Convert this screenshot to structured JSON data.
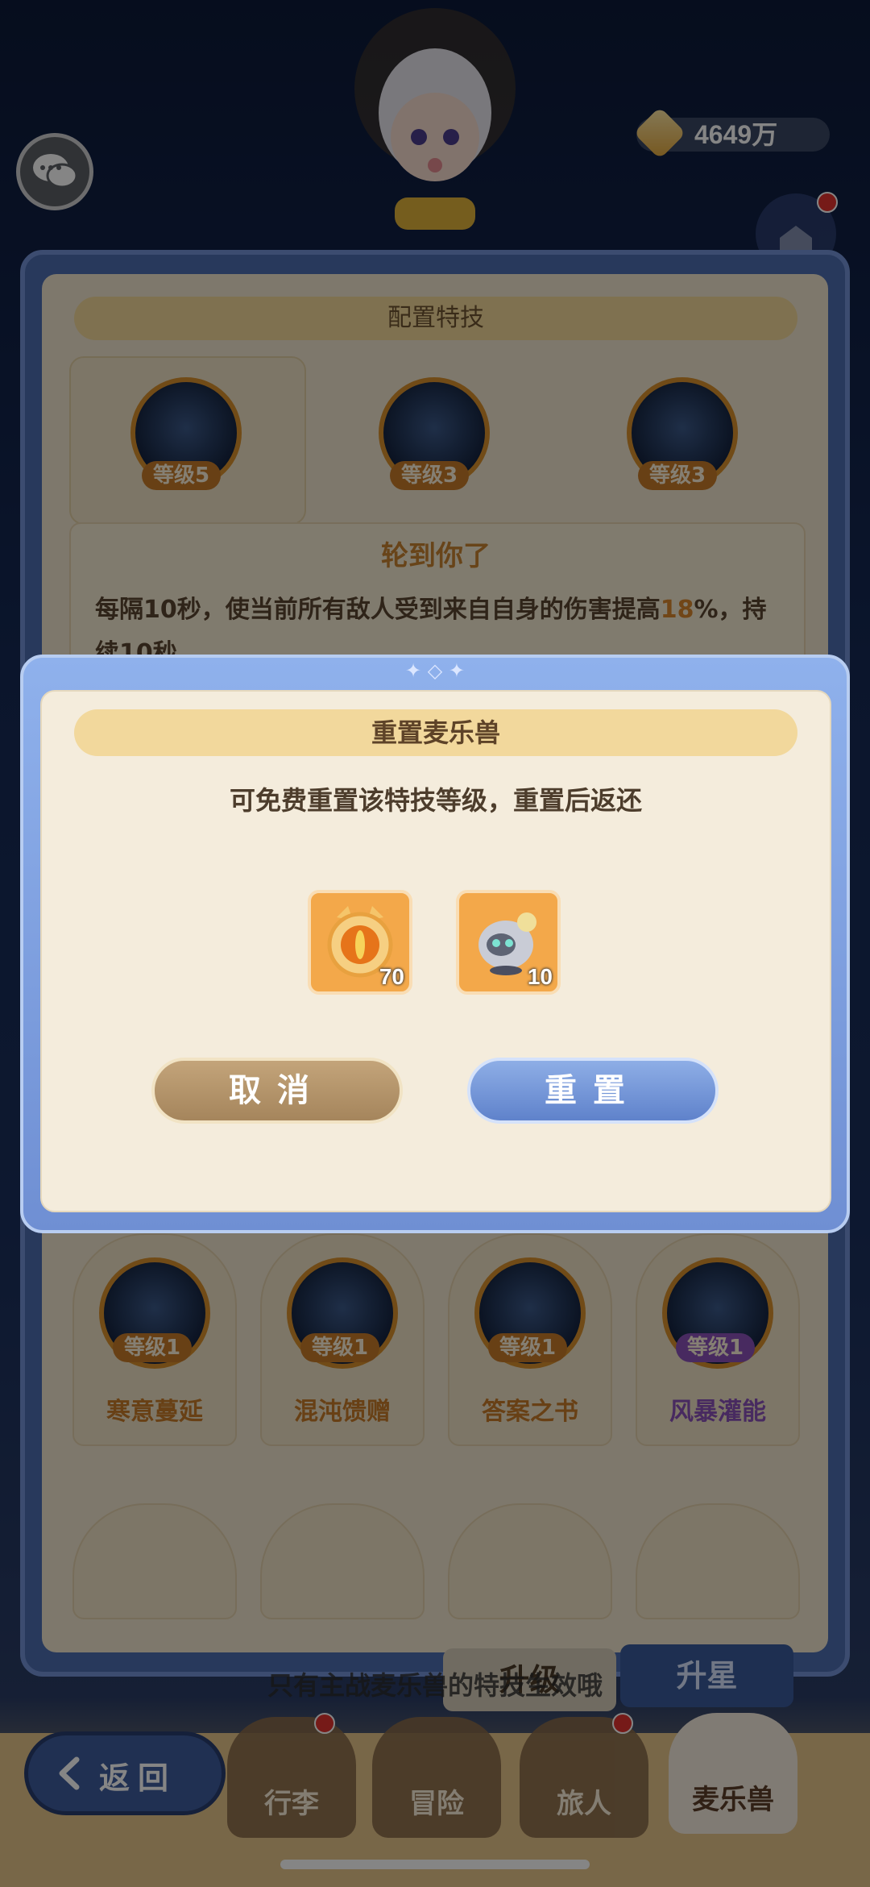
{
  "hud": {
    "gold": "4649万"
  },
  "skills_panel": {
    "title": "配置特技",
    "slots": [
      {
        "level": "等级5"
      },
      {
        "level": "等级3"
      },
      {
        "level": "等级3"
      }
    ],
    "skill_name": "轮到你了",
    "desc_part1": "每隔10秒，使当前所有敌人受到来自自身的伤害提高",
    "desc_highlight": "18",
    "desc_part2": "%，持续10秒",
    "grid": [
      {
        "level": "等级1",
        "name": "寒意蔓延",
        "color": "#c77c2a"
      },
      {
        "level": "等级1",
        "name": "混沌馈赠",
        "color": "#c77c2a"
      },
      {
        "level": "等级1",
        "name": "答案之书",
        "color": "#c77c2a"
      },
      {
        "level": "等级1",
        "name": "风暴灌能",
        "color": "#8a52b8"
      }
    ]
  },
  "bottom": {
    "hint": "只有主战麦乐兽的特技生效哦",
    "upgrade": "升级",
    "star": "升星"
  },
  "nav": {
    "back": "返回",
    "items": [
      "行李",
      "冒险",
      "旅人",
      "麦乐兽"
    ]
  },
  "modal": {
    "title": "重置麦乐兽",
    "message": "可免费重置该特技等级，重置后返还",
    "items": [
      {
        "icon": "orb-icon",
        "qty": "70"
      },
      {
        "icon": "ghost-pet-icon",
        "qty": "10"
      }
    ],
    "cancel": "取消",
    "confirm": "重置"
  },
  "colors": {
    "accent_gold": "#c77c2a",
    "modal_blue": "#6f8fd3",
    "cancel_tan": "#a5855c"
  }
}
